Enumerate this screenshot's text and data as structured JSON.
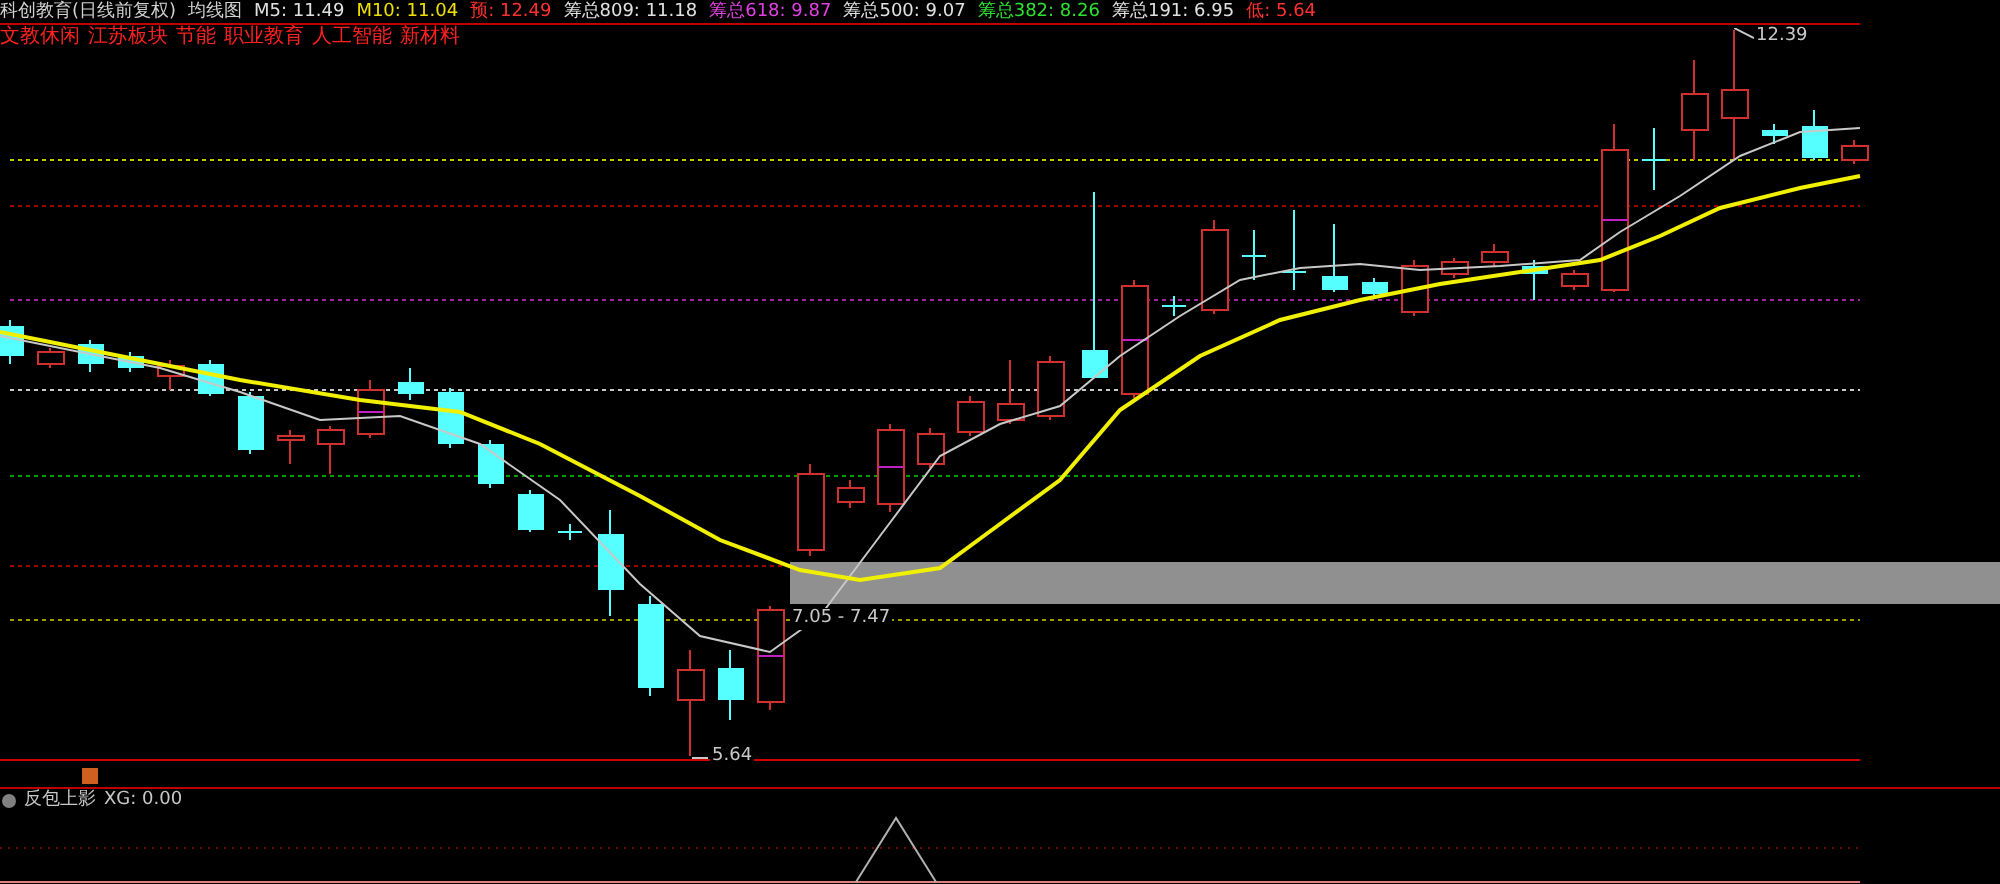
{
  "header": {
    "items": [
      {
        "text": "科创教育(日线前复权)",
        "color": "#d0d0d0"
      },
      {
        "text": "均线图",
        "color": "#d0d0d0"
      },
      {
        "text": "M5: 11.49",
        "color": "#e0e0e0"
      },
      {
        "text": "M10: 11.04",
        "color": "#f0e000"
      },
      {
        "text": "预: 12.49",
        "color": "#ff3030"
      },
      {
        "text": "筹总809: 11.18",
        "color": "#e0e0e0"
      },
      {
        "text": "筹总618: 9.87",
        "color": "#e040e0"
      },
      {
        "text": "筹总500: 9.07",
        "color": "#e0e0e0"
      },
      {
        "text": "筹总382: 8.26",
        "color": "#30e030"
      },
      {
        "text": "筹总191: 6.95",
        "color": "#e0e0e0"
      },
      {
        "text": "低: 5.64",
        "color": "#ff3030"
      }
    ]
  },
  "tags": [
    "文教休闲",
    "江苏板块",
    "节能",
    "职业教育",
    "人工智能",
    "新材料"
  ],
  "price_labels": {
    "high": "12.39",
    "range": "7.05 - 7.47",
    "low": "5.64"
  },
  "indicator": {
    "name": "反包上影",
    "reading": "XG: 0.00"
  }
}
